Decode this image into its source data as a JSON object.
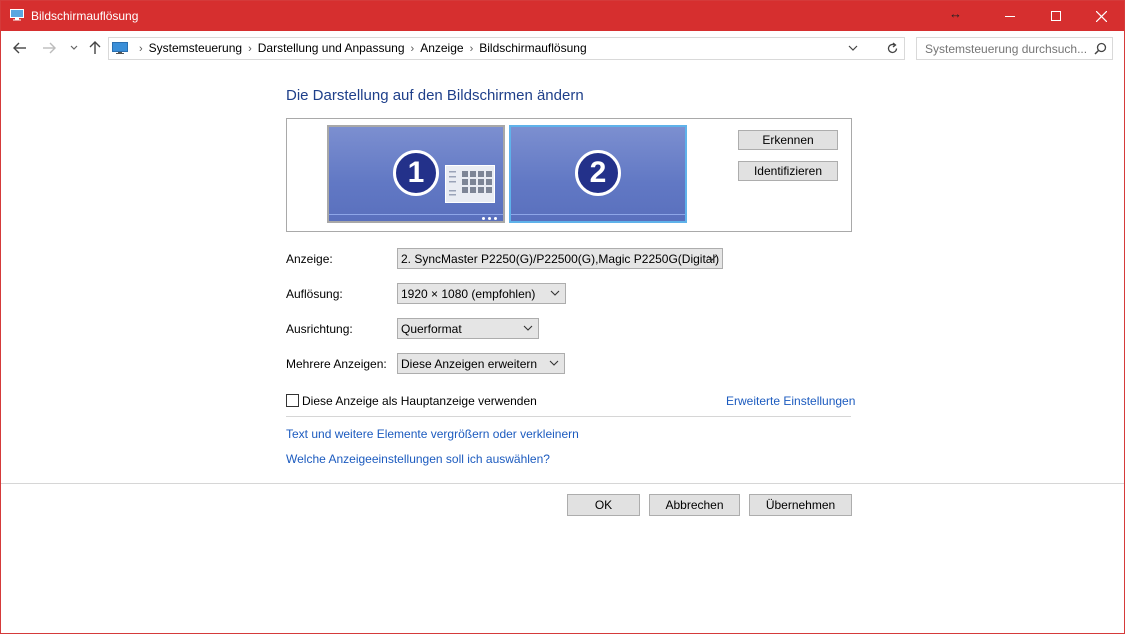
{
  "window": {
    "title": "Bildschirmauflösung",
    "resize_glyph": "↔",
    "accent_color": "#d62f2f"
  },
  "address_bar": {
    "breadcrumbs": [
      "Systemsteuerung",
      "Darstellung und Anpassung",
      "Anzeige",
      "Bildschirmauflösung"
    ],
    "search_placeholder": "Systemsteuerung durchsuch..."
  },
  "main": {
    "heading": "Die Darstellung auf den Bildschirmen ändern",
    "monitors": [
      {
        "number": "1",
        "selected": false
      },
      {
        "number": "2",
        "selected": true
      }
    ],
    "buttons": {
      "detect": "Erkennen",
      "identify": "Identifizieren"
    },
    "fields": {
      "display_label": "Anzeige:",
      "display_value": "2. SyncMaster P2250(G)/P22500(G),Magic P2250G(Digital)",
      "resolution_label": "Auflösung:",
      "resolution_value": "1920 × 1080 (empfohlen)",
      "orientation_label": "Ausrichtung:",
      "orientation_value": "Querformat",
      "multiple_label": "Mehrere Anzeigen:",
      "multiple_value": "Diese Anzeigen erweitern"
    },
    "main_display_checkbox": {
      "label": "Diese Anzeige als Hauptanzeige verwenden",
      "checked": false
    },
    "advanced_link": "Erweiterte Einstellungen",
    "links": [
      "Text und weitere Elemente vergrößern oder verkleinern",
      "Welche Anzeigeeinstellungen soll ich auswählen?"
    ]
  },
  "footer": {
    "ok": "OK",
    "cancel": "Abbrechen",
    "apply": "Übernehmen"
  }
}
